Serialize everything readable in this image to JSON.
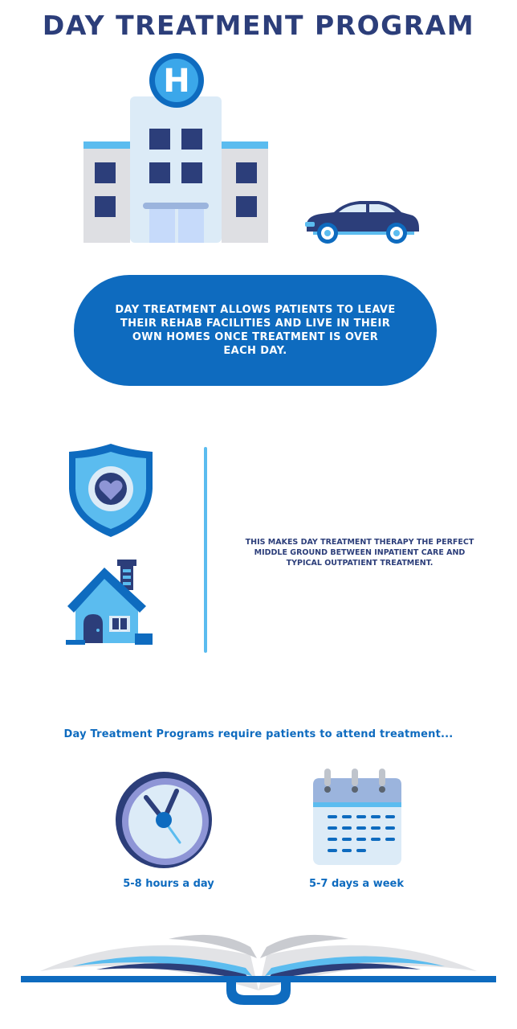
{
  "header": {
    "title": "DAY TREATMENT PROGRAM"
  },
  "intro": {
    "text": "DAY TREATMENT ALLOWS PATIENTS TO LEAVE THEIR REHAB FACILITIES AND LIVE IN THEIR OWN HOMES ONCE TREATMENT IS OVER EACH DAY."
  },
  "middle": {
    "text": "THIS MAKES DAY TREATMENT THERAPY THE PERFECT MIDDLE GROUND BETWEEN INPATIENT CARE AND TYPICAL OUTPATIENT TREATMENT."
  },
  "requirements": {
    "heading": "Day Treatment Programs require patients to attend treatment...",
    "hours": "5-8 hours a day",
    "days": "5-7 days a week"
  },
  "icons": {
    "hospital_sign": "H",
    "hospital": "hospital-icon",
    "car": "car-icon",
    "shield": "shield-heart-icon",
    "house": "house-icon",
    "clock": "clock-icon",
    "calendar": "calendar-icon",
    "book": "open-book-icon"
  },
  "colors": {
    "navy": "#2c3e7a",
    "brand_blue": "#0e6bbf",
    "light_blue": "#5bbcef",
    "pale_blue": "#dcebf7"
  }
}
